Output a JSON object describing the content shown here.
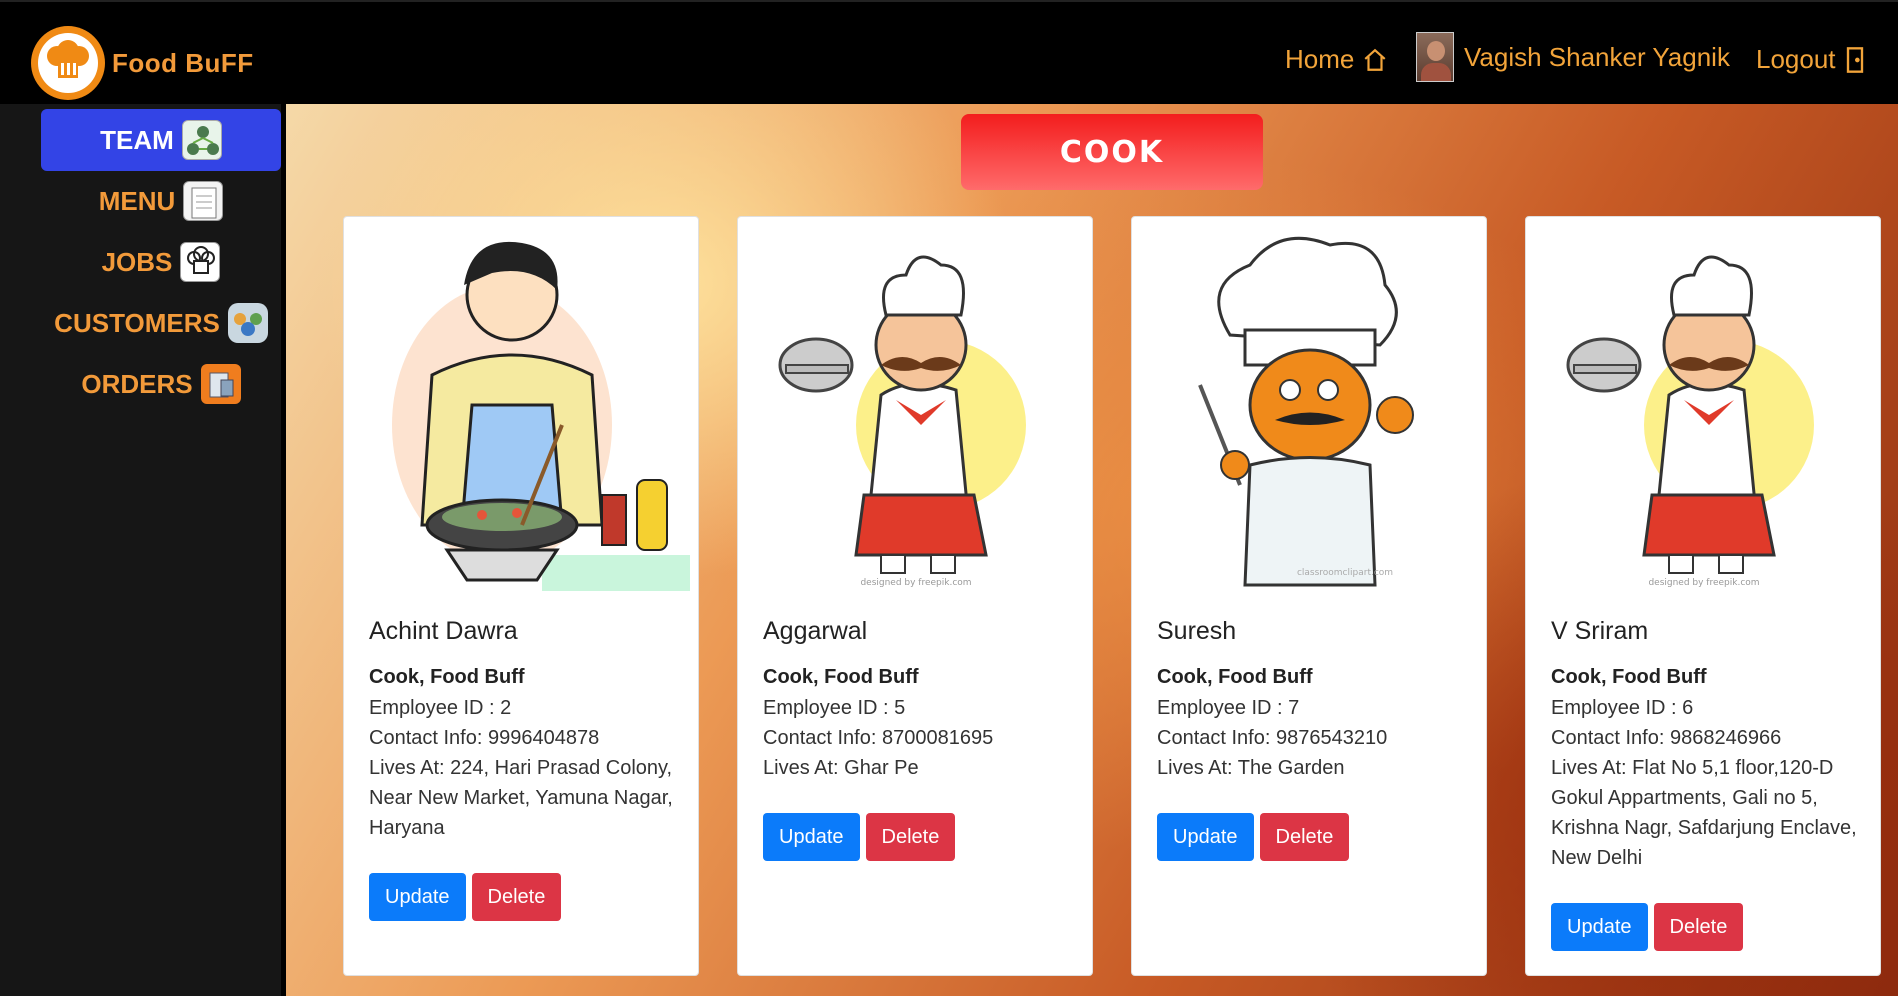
{
  "brand": {
    "name": "Food BuFF",
    "logo_icon": "chef-hat-logo-icon"
  },
  "nav": {
    "home_label": "Home",
    "home_icon": "house-icon",
    "user_name": "Vagish Shanker Yagnik",
    "logout_label": "Logout",
    "logout_icon": "door-icon"
  },
  "sidebar": {
    "items": [
      {
        "label": "TEAM",
        "icon": "team-icon",
        "active": true
      },
      {
        "label": "MENU",
        "icon": "menu-card-icon",
        "active": false
      },
      {
        "label": "JOBS",
        "icon": "chef-hat-icon",
        "active": false
      },
      {
        "label": "CUSTOMERS",
        "icon": "customers-icon",
        "active": false
      },
      {
        "label": "ORDERS",
        "icon": "orders-icon",
        "active": false
      }
    ]
  },
  "main": {
    "section_title": "COOK",
    "cards": [
      {
        "name": "Achint Dawra",
        "role": "Cook, Food Buff",
        "employee_id": "Employee ID : 2",
        "contact": "Contact Info: 9996404878",
        "lives": "Lives At: 224, Hari Prasad Colony, Near New Market, Yamuna Nagar, Haryana",
        "update_label": "Update",
        "delete_label": "Delete",
        "image": "man-cooking-wok-illustration"
      },
      {
        "name": "Aggarwal",
        "role": "Cook, Food Buff",
        "employee_id": "Employee ID : 5",
        "contact": "Contact Info: 8700081695",
        "lives": "Lives At: Ghar Pe",
        "update_label": "Update",
        "delete_label": "Delete",
        "image": "chef-with-cloche-illustration",
        "credit": "designed by freepik.com"
      },
      {
        "name": "Suresh",
        "role": "Cook, Food Buff",
        "employee_id": "Employee ID : 7",
        "contact": "Contact Info: 9876543210",
        "lives": "Lives At: The Garden",
        "update_label": "Update",
        "delete_label": "Delete",
        "image": "chef-ok-sign-illustration",
        "credit": "classroomclipart.com"
      },
      {
        "name": "V Sriram",
        "role": "Cook, Food Buff",
        "employee_id": "Employee ID : 6",
        "contact": "Contact Info: 9868246966",
        "lives": "Lives At: Flat No 5,1 floor,120-D Gokul Appartments, Gali no 5, Krishna Nagr, Safdarjung Enclave, New Delhi",
        "update_label": "Update",
        "delete_label": "Delete",
        "image": "chef-with-cloche-illustration",
        "credit": "designed by freepik.com"
      }
    ]
  },
  "colors": {
    "accent_orange": "#f29a3a",
    "active_blue": "#3344e6",
    "update_blue": "#0b7bfa",
    "delete_red": "#dc3545",
    "banner_red": "#f31d1d"
  }
}
